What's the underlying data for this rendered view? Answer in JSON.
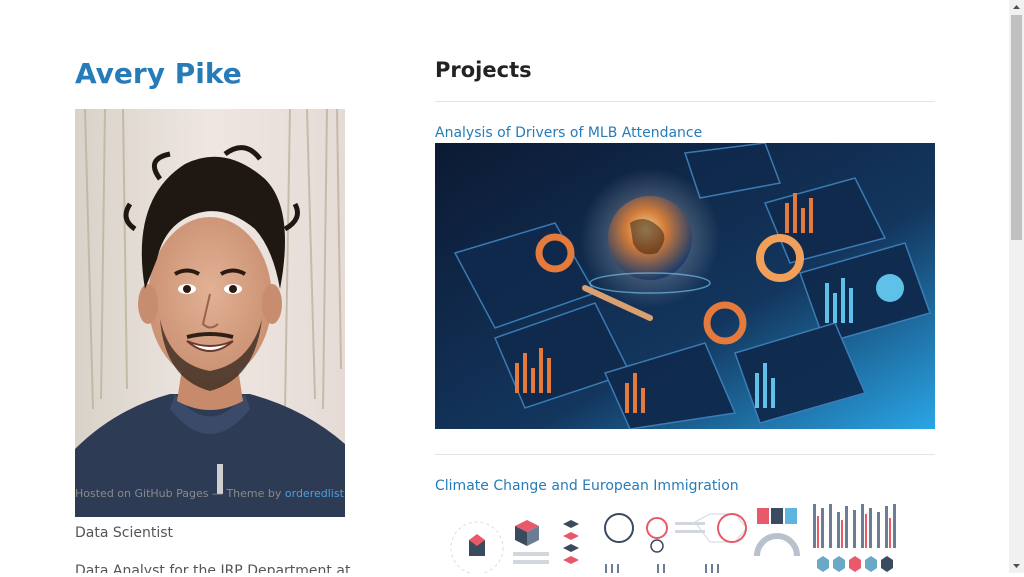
{
  "profile": {
    "name": "Avery Pike",
    "role": "Data Scientist",
    "bio_start": "Data Analyst for the IRP Department at"
  },
  "footer": {
    "hosted_text": "Hosted on GitHub Pages — Theme by",
    "theme_author": "orderedlist"
  },
  "projects": {
    "heading": "Projects",
    "items": [
      {
        "title": "Analysis of Drivers of MLB Attendance"
      },
      {
        "title": "Climate Change and European Immigration"
      }
    ]
  },
  "icons": {
    "scroll_up": "triangle-up",
    "scroll_down": "triangle-down"
  },
  "colors": {
    "link": "#267CB9",
    "heading": "#222222",
    "body_text": "#555555",
    "rule": "#e5e5e5"
  }
}
